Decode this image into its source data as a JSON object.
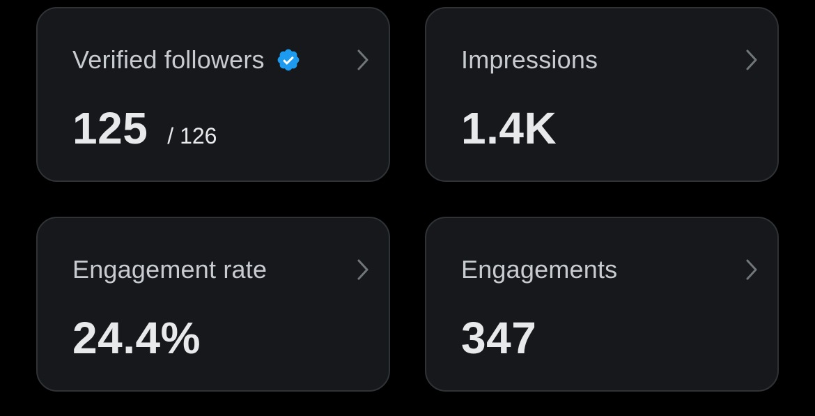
{
  "colors": {
    "background": "#000000",
    "card_background": "#16181c",
    "card_border": "#2f3336",
    "title_text": "#c8ccd0",
    "value_text": "#e7e9ea",
    "verified_badge": "#1d9bf0",
    "chevron": "#71767b"
  },
  "cards": [
    {
      "title": "Verified followers",
      "value": "125",
      "total": "/ 126",
      "title_icon": "verified-badge-icon",
      "action_icon": "chevron-right-icon"
    },
    {
      "title": "Impressions",
      "value": "1.4K",
      "action_icon": "chevron-right-icon"
    },
    {
      "title": "Engagement rate",
      "value": "24.4%",
      "action_icon": "chevron-right-icon"
    },
    {
      "title": "Engagements",
      "value": "347",
      "action_icon": "chevron-right-icon"
    }
  ]
}
